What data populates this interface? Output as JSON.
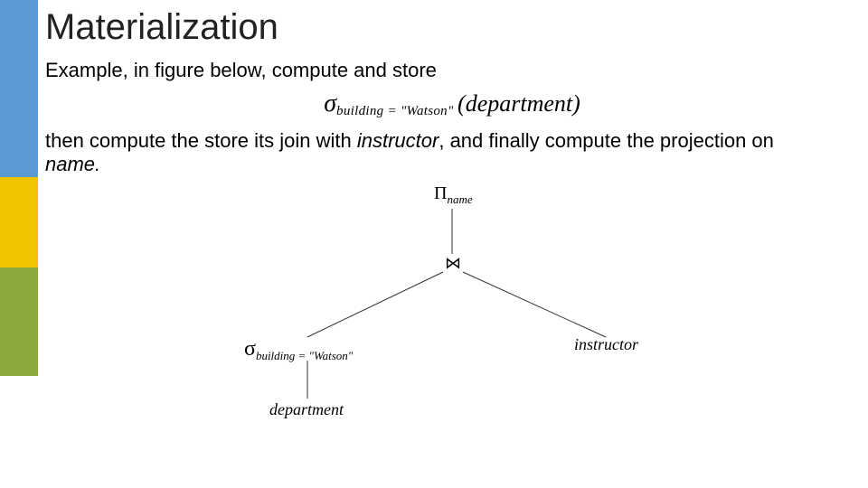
{
  "title": "Materialization",
  "intro": "Example, in figure below, compute and store",
  "formula": {
    "sigma": "σ",
    "subscript": "building = \"Watson\"",
    "rel": "(department)"
  },
  "follow1a": "then compute the store its join with ",
  "follow_instr": "instructor",
  "follow1b": ", and finally compute the projection on ",
  "follow_name": "name.",
  "tree": {
    "proj": "Π",
    "proj_sub": "name",
    "join": "⋈",
    "sel": "σ",
    "sel_sub": "building = \"Watson\"",
    "right_leaf": "instructor",
    "left_leaf": "department"
  }
}
